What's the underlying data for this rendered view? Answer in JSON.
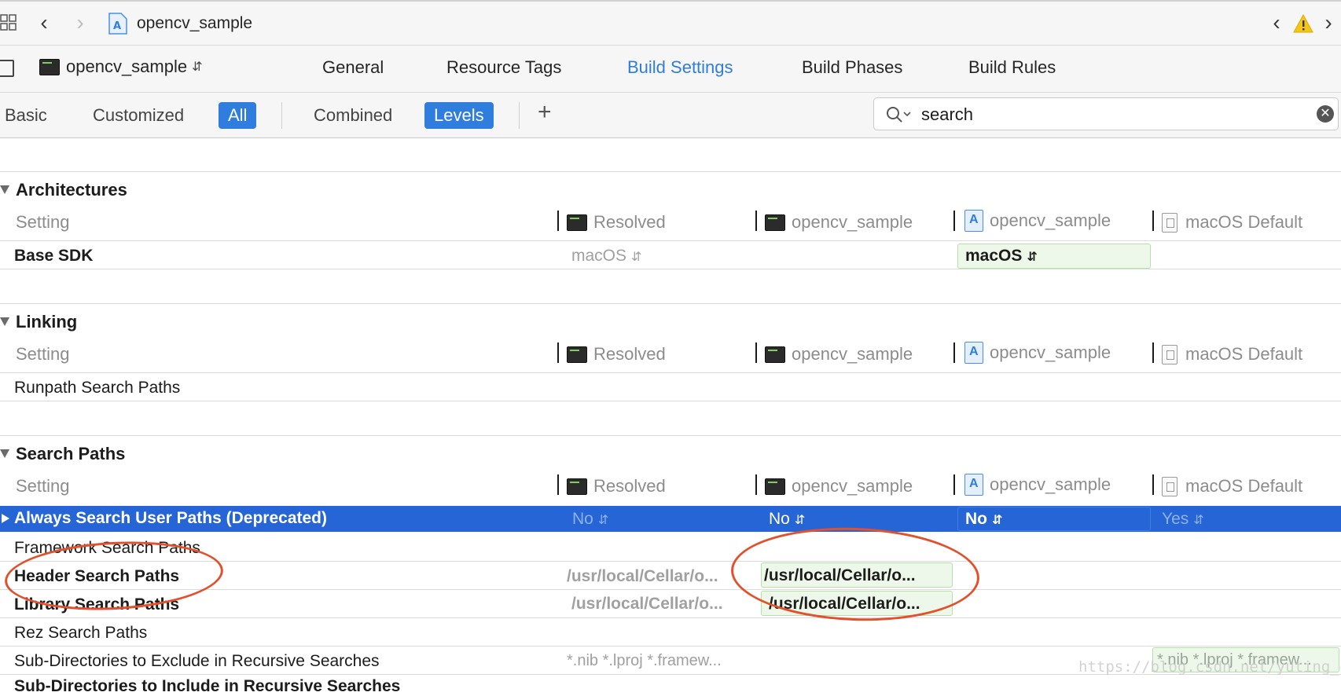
{
  "window": {
    "project_name": "opencv_sample",
    "target_name": "opencv_sample"
  },
  "tabs": [
    "General",
    "Resource Tags",
    "Build Settings",
    "Build Phases",
    "Build Rules"
  ],
  "active_tab": "Build Settings",
  "filter": {
    "basic": "Basic",
    "customized": "Customized",
    "all": "All",
    "combined": "Combined",
    "levels": "Levels",
    "add": "+"
  },
  "search": {
    "value": "search"
  },
  "columns": {
    "setting": "Setting",
    "resolved": "Resolved",
    "target": "opencv_sample",
    "project": "opencv_sample",
    "default": "macOS Default"
  },
  "sections": {
    "architectures": {
      "title": "Architectures",
      "base_sdk": {
        "label": "Base SDK",
        "resolved": "macOS",
        "project": "macOS"
      }
    },
    "linking": {
      "title": "Linking",
      "runpath": {
        "label": "Runpath Search Paths"
      }
    },
    "search_paths": {
      "title": "Search Paths",
      "always_search": {
        "label": "Always Search User Paths (Deprecated)",
        "resolved": "No",
        "target": "No",
        "project": "No",
        "default": "Yes"
      },
      "framework": {
        "label": "Framework Search Paths"
      },
      "header": {
        "label": "Header Search Paths",
        "resolved": "/usr/local/Cellar/o...",
        "target": "/usr/local/Cellar/o..."
      },
      "library": {
        "label": "Library Search Paths",
        "resolved": "/usr/local/Cellar/o...",
        "target": "/usr/local/Cellar/o..."
      },
      "rez": {
        "label": "Rez Search Paths"
      },
      "exclude": {
        "label": "Sub-Directories to Exclude in Recursive Searches",
        "resolved": "*.nib *.lproj *.framew...",
        "default": "*.nib *.lproj *.framew..."
      },
      "include": {
        "label": "Sub-Directories to Include in Recursive Searches"
      }
    }
  },
  "watermark": "https://blog.csdn.net/yuting_car",
  "colors": {
    "accent": "#2f7ddc",
    "selection": "#2565d6",
    "annotation": "#e2502c",
    "override_bg": "#eef8ea"
  }
}
